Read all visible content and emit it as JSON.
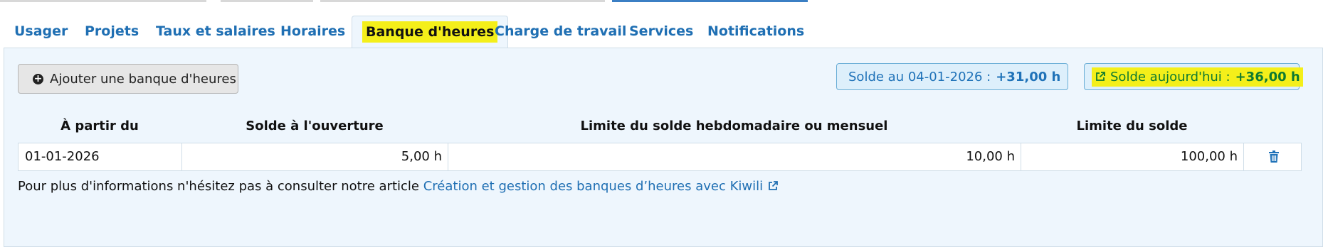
{
  "tabs": [
    {
      "label": "Usager"
    },
    {
      "label": "Projets"
    },
    {
      "label": "Taux et salaires"
    },
    {
      "label": "Horaires"
    },
    {
      "label": "Banque d'heures",
      "active": true
    },
    {
      "label": "Charge de travail"
    },
    {
      "label": "Services"
    },
    {
      "label": "Notifications"
    }
  ],
  "toolbar": {
    "add_label": "Ajouter une banque d'heures",
    "solde_date_label": "Solde au 04-01-2026 :",
    "solde_date_value": "+31,00 h",
    "solde_today_label": "Solde aujourd'hui :",
    "solde_today_value": "+36,00 h"
  },
  "table": {
    "headers": [
      "À partir du",
      "Solde à l'ouverture",
      "Limite du solde hebdomadaire ou mensuel",
      "Limite du solde"
    ],
    "rows": [
      {
        "date": "01-01-2026",
        "opening": "5,00 h",
        "period_limit": "10,00 h",
        "limit": "100,00 h"
      }
    ]
  },
  "info": {
    "text": "Pour plus d'informations n'hésitez pas à consulter notre article",
    "link": "Création et gestion des banques d’heures avec Kiwili"
  },
  "colors": {
    "accent": "#1f6fb3",
    "highlight": "#f4ef1a",
    "panel_bg": "#eef6fd",
    "today_value": "#0f7a30"
  },
  "icons": [
    "plus-circle-icon",
    "external-link-icon",
    "trash-icon"
  ]
}
